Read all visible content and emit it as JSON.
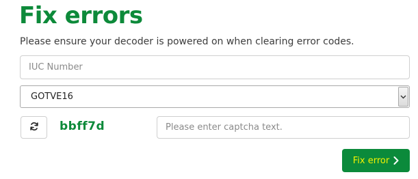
{
  "page": {
    "title": "Fix errors",
    "subtitle": "Please ensure your decoder is powered on when clearing error codes."
  },
  "form": {
    "iuc": {
      "value": "",
      "placeholder": "IUC Number"
    },
    "product_select": {
      "selected": "GOTVE16"
    },
    "captcha": {
      "code": "bbff7d",
      "input_value": "",
      "input_placeholder": "Please enter captcha text."
    },
    "submit": {
      "label": "Fix error"
    }
  },
  "icons": {
    "refresh": "refresh-icon",
    "dropdown": "chevron-down-icon",
    "submit_arrow": "chevron-right-icon"
  },
  "colors": {
    "brand_green": "#0d8a3a",
    "button_label": "#f2f200"
  }
}
